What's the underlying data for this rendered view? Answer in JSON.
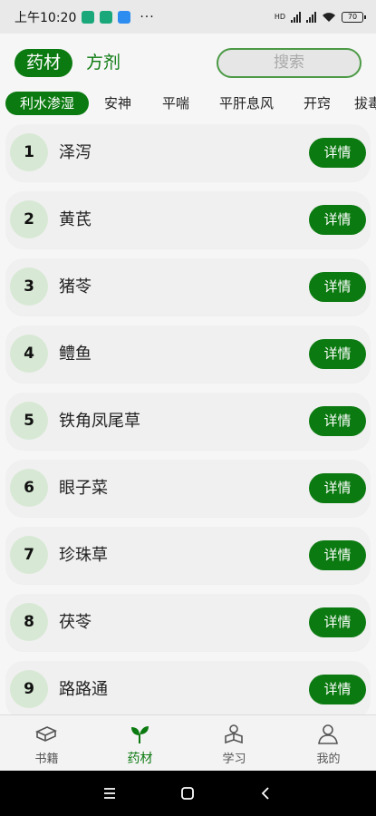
{
  "status_bar": {
    "time": "上午10:20",
    "dots": "···",
    "network_1": "HD",
    "battery": "70",
    "app_icon_colors": [
      "#1aa87a",
      "#1aa87a",
      "#2d8cf0"
    ]
  },
  "header": {
    "segments": [
      "药材",
      "方剂"
    ],
    "active_segment": "药材",
    "search_placeholder": "搜索"
  },
  "category_tabs": [
    "利水渗湿",
    "安神",
    "平喘",
    "平肝息风",
    "开窍",
    "拔毒化"
  ],
  "active_category": "利水渗湿",
  "herbs": [
    {
      "num": "1",
      "name": "泽泻",
      "button": "详情"
    },
    {
      "num": "2",
      "name": "黄芪",
      "button": "详情"
    },
    {
      "num": "3",
      "name": "猪苓",
      "button": "详情"
    },
    {
      "num": "4",
      "name": "鳢鱼",
      "button": "详情"
    },
    {
      "num": "5",
      "name": "铁角凤尾草",
      "button": "详情"
    },
    {
      "num": "6",
      "name": "眼子菜",
      "button": "详情"
    },
    {
      "num": "7",
      "name": "珍珠草",
      "button": "详情"
    },
    {
      "num": "8",
      "name": "茯苓",
      "button": "详情"
    },
    {
      "num": "9",
      "name": "路路通",
      "button": "详情"
    }
  ],
  "bottom_nav": [
    {
      "label": "书籍",
      "icon": "book-icon",
      "active": false
    },
    {
      "label": "药材",
      "icon": "sprout-icon",
      "active": true
    },
    {
      "label": "学习",
      "icon": "study-icon",
      "active": false
    },
    {
      "label": "我的",
      "icon": "user-icon",
      "active": false
    }
  ],
  "colors": {
    "accent": "#0b7a10",
    "number_badge": "#d7e9d4",
    "card_bg": "#f0f0f0"
  }
}
